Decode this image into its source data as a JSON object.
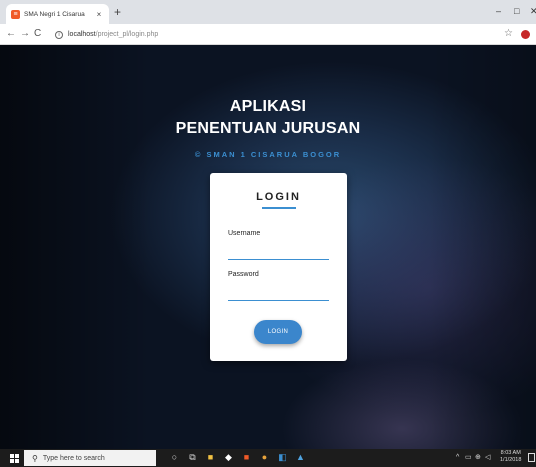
{
  "browser": {
    "tab_title": "SMA Negri 1 Cisarua",
    "tab_close": "×",
    "new_tab": "+",
    "minimize": "–",
    "maximize": "□",
    "close": "✕",
    "back": "←",
    "forward": "→",
    "reload": "C",
    "url_host": "localhost",
    "url_path": "/project_pl/login.php",
    "bookmark_star": "☆"
  },
  "page": {
    "title_line1": "APLIKASI",
    "title_line2": "PENENTUAN JURUSAN",
    "subtitle": "© SMAN 1 CISARUA BOGOR",
    "login_heading": "LOGIN",
    "username_label": "Username",
    "username_value": "",
    "password_label": "Password",
    "password_value": "",
    "login_button": "LOGIN"
  },
  "taskbar": {
    "search_placeholder": "Type here to search",
    "clock_time": "8:03 AM",
    "clock_date": "1/1/2018"
  },
  "colors": {
    "accent": "#3b8fd1",
    "button": "#3b86cc",
    "background_dark": "#0b1322"
  }
}
